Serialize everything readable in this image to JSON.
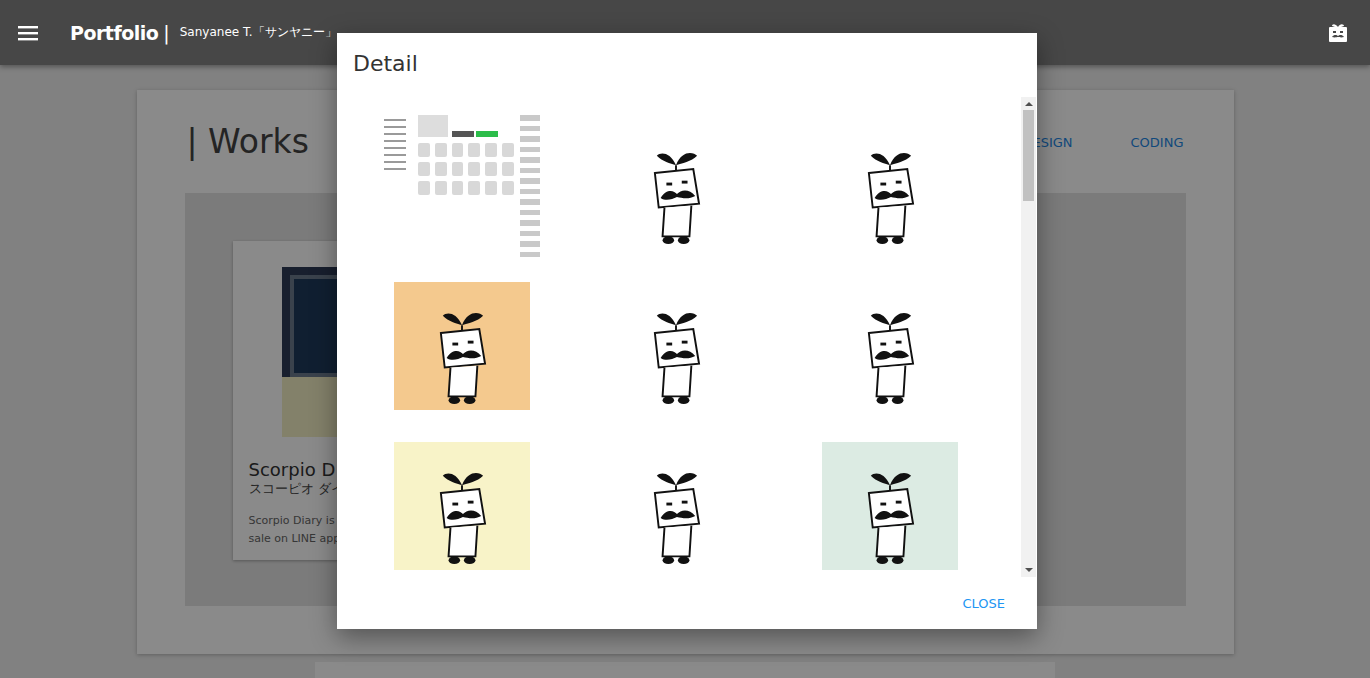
{
  "header": {
    "title": "Portfolio",
    "separator": "|",
    "subtitle": "Sanyanee T.「サンヤニー」"
  },
  "page": {
    "heading": "| Works",
    "tabs": [
      {
        "label": "ESIGN",
        "selected": false
      },
      {
        "label": "CODING",
        "selected": false
      }
    ],
    "card": {
      "title": "Scorpio D",
      "subtitle": "スコーピオ ダイ",
      "description": [
        "Scorpio  Diary is o",
        "sale on  LINE appl"
      ],
      "color": "#f3efc4"
    }
  },
  "dialog": {
    "title": "Detail",
    "images": [
      {
        "kind": "screenshot",
        "color": "#ffffff"
      },
      {
        "kind": "sticker",
        "color": "#ffffff"
      },
      {
        "kind": "sticker",
        "color": "#ffffff"
      },
      {
        "kind": "sticker",
        "color": "#f4c98e"
      },
      {
        "kind": "sticker",
        "color": "#ffffff"
      },
      {
        "kind": "sticker",
        "color": "#ffffff"
      },
      {
        "kind": "sticker",
        "color": "#f8f3c8"
      },
      {
        "kind": "sticker",
        "color": "#ffffff"
      },
      {
        "kind": "sticker",
        "color": "#dcebe3"
      }
    ],
    "scrollbar": {
      "level": 0.2
    },
    "buttons": [
      "CLOSE"
    ]
  }
}
